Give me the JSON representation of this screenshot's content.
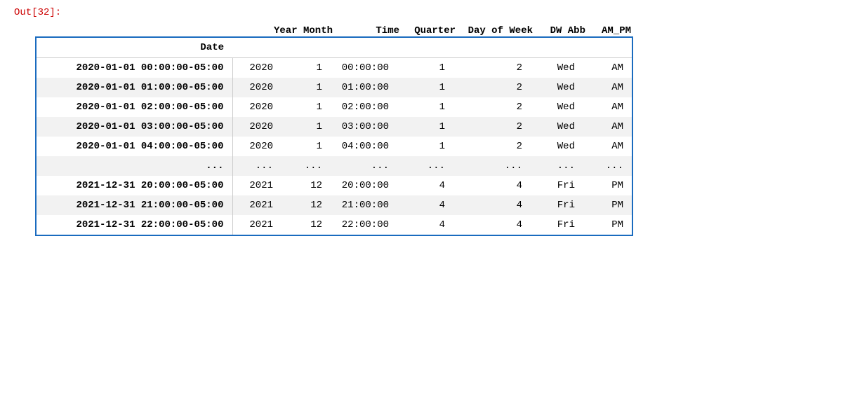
{
  "out_label": "Out[32]:",
  "column_headers": {
    "year_month": "Year Month",
    "time": "Time",
    "quarter": "Quarter",
    "day_of_week": "Day of Week",
    "dw_abb": "DW Abb",
    "am_pm": "AM_PM"
  },
  "table_header": {
    "date": "Date"
  },
  "rows": [
    {
      "date": "2020-01-01 00:00:00-05:00",
      "year": "2020",
      "month": "1",
      "time": "00:00:00",
      "quarter": "1",
      "dow": "2",
      "dw_abb": "Wed",
      "am_pm": "AM"
    },
    {
      "date": "2020-01-01 01:00:00-05:00",
      "year": "2020",
      "month": "1",
      "time": "01:00:00",
      "quarter": "1",
      "dow": "2",
      "dw_abb": "Wed",
      "am_pm": "AM"
    },
    {
      "date": "2020-01-01 02:00:00-05:00",
      "year": "2020",
      "month": "1",
      "time": "02:00:00",
      "quarter": "1",
      "dow": "2",
      "dw_abb": "Wed",
      "am_pm": "AM"
    },
    {
      "date": "2020-01-01 03:00:00-05:00",
      "year": "2020",
      "month": "1",
      "time": "03:00:00",
      "quarter": "1",
      "dow": "2",
      "dw_abb": "Wed",
      "am_pm": "AM"
    },
    {
      "date": "2020-01-01 04:00:00-05:00",
      "year": "2020",
      "month": "1",
      "time": "04:00:00",
      "quarter": "1",
      "dow": "2",
      "dw_abb": "Wed",
      "am_pm": "AM"
    },
    {
      "date": "...",
      "year": "...",
      "month": "...",
      "time": "...",
      "quarter": "...",
      "dow": "...",
      "dw_abb": "...",
      "am_pm": "..."
    },
    {
      "date": "2021-12-31 20:00:00-05:00",
      "year": "2021",
      "month": "12",
      "time": "20:00:00",
      "quarter": "4",
      "dow": "4",
      "dw_abb": "Fri",
      "am_pm": "PM"
    },
    {
      "date": "2021-12-31 21:00:00-05:00",
      "year": "2021",
      "month": "12",
      "time": "21:00:00",
      "quarter": "4",
      "dow": "4",
      "dw_abb": "Fri",
      "am_pm": "PM"
    },
    {
      "date": "2021-12-31 22:00:00-05:00",
      "year": "2021",
      "month": "12",
      "time": "22:00:00",
      "quarter": "4",
      "dow": "4",
      "dw_abb": "Fri",
      "am_pm": "PM"
    }
  ]
}
